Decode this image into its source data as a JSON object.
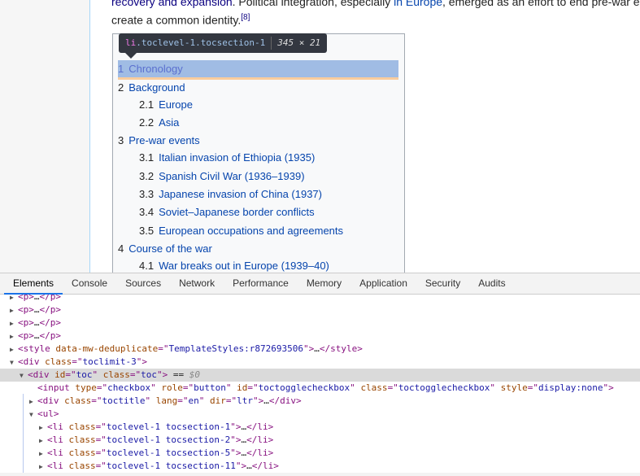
{
  "article": {
    "line1": [
      {
        "text": "recovery and expansion",
        "link": true
      },
      {
        "text": ". Political integration, especially ",
        "link": false
      },
      {
        "text": "in Europe",
        "link": true
      },
      {
        "text": ", emerged as an effort to end pre-war e",
        "link": false
      }
    ],
    "line2": "create a common identity.",
    "ref": "[8]"
  },
  "toc": {
    "items": [
      {
        "num": "1",
        "label": "Chronology",
        "level": 1,
        "highlighted": true
      },
      {
        "num": "2",
        "label": "Background",
        "level": 1
      },
      {
        "num": "2.1",
        "label": "Europe",
        "level": 2
      },
      {
        "num": "2.2",
        "label": "Asia",
        "level": 2
      },
      {
        "num": "3",
        "label": "Pre-war events",
        "level": 1
      },
      {
        "num": "3.1",
        "label": "Italian invasion of Ethiopia (1935)",
        "level": 2
      },
      {
        "num": "3.2",
        "label": "Spanish Civil War (1936–1939)",
        "level": 2
      },
      {
        "num": "3.3",
        "label": "Japanese invasion of China (1937)",
        "level": 2
      },
      {
        "num": "3.4",
        "label": "Soviet–Japanese border conflicts",
        "level": 2
      },
      {
        "num": "3.5",
        "label": "European occupations and agreements",
        "level": 2
      },
      {
        "num": "4",
        "label": "Course of the war",
        "level": 1
      },
      {
        "num": "4.1",
        "label": "War breaks out in Europe (1939–40)",
        "level": 2
      }
    ]
  },
  "tooltip": {
    "tag": "li",
    "classes": ".toclevel-1.tocsection-1",
    "size": "345 × 21"
  },
  "devtools": {
    "tabs": [
      "Elements",
      "Console",
      "Sources",
      "Network",
      "Performance",
      "Memory",
      "Application",
      "Security",
      "Audits"
    ],
    "active_tab": "Elements",
    "lines": [
      {
        "indent": 1,
        "tri": "▶",
        "segs": [
          [
            "t",
            "<p>"
          ],
          [
            "tx",
            "…"
          ],
          [
            "t",
            "</p>"
          ]
        ]
      },
      {
        "indent": 1,
        "tri": "▶",
        "segs": [
          [
            "t",
            "<p>"
          ],
          [
            "tx",
            "…"
          ],
          [
            "t",
            "</p>"
          ]
        ]
      },
      {
        "indent": 1,
        "tri": "▶",
        "segs": [
          [
            "t",
            "<p>"
          ],
          [
            "tx",
            "…"
          ],
          [
            "t",
            "</p>"
          ]
        ]
      },
      {
        "indent": 1,
        "tri": "▶",
        "segs": [
          [
            "t",
            "<p>"
          ],
          [
            "tx",
            "…"
          ],
          [
            "t",
            "</p>"
          ]
        ]
      },
      {
        "indent": 1,
        "tri": "▶",
        "segs": [
          [
            "t",
            "<style "
          ],
          [
            "an",
            "data-mw-deduplicate"
          ],
          [
            "t",
            "=\""
          ],
          [
            "av",
            "TemplateStyles:r872693506"
          ],
          [
            "t",
            "\">"
          ],
          [
            "tx",
            "…"
          ],
          [
            "t",
            "</style>"
          ]
        ]
      },
      {
        "indent": 1,
        "tri": "▼",
        "segs": [
          [
            "t",
            "<div "
          ],
          [
            "an",
            "class"
          ],
          [
            "t",
            "=\""
          ],
          [
            "av",
            "toclimit-3"
          ],
          [
            "t",
            "\">"
          ]
        ]
      },
      {
        "indent": 2,
        "tri": "▼",
        "selected": true,
        "segs": [
          [
            "t",
            "<div "
          ],
          [
            "an",
            "id"
          ],
          [
            "t",
            "=\""
          ],
          [
            "av",
            "toc"
          ],
          [
            "t",
            "\" "
          ],
          [
            "an",
            "class"
          ],
          [
            "t",
            "=\""
          ],
          [
            "av",
            "toc"
          ],
          [
            "t",
            "\">"
          ],
          [
            "tx",
            " == "
          ],
          [
            "dim",
            "$0"
          ]
        ]
      },
      {
        "indent": 3,
        "tri": "",
        "segs": [
          [
            "t",
            "<input "
          ],
          [
            "an",
            "type"
          ],
          [
            "t",
            "=\""
          ],
          [
            "av",
            "checkbox"
          ],
          [
            "t",
            "\" "
          ],
          [
            "an",
            "role"
          ],
          [
            "t",
            "=\""
          ],
          [
            "av",
            "button"
          ],
          [
            "t",
            "\" "
          ],
          [
            "an",
            "id"
          ],
          [
            "t",
            "=\""
          ],
          [
            "av",
            "toctogglecheckbox"
          ],
          [
            "t",
            "\" "
          ],
          [
            "an",
            "class"
          ],
          [
            "t",
            "=\""
          ],
          [
            "av",
            "toctogglecheckbox"
          ],
          [
            "t",
            "\" "
          ],
          [
            "an",
            "style"
          ],
          [
            "t",
            "=\""
          ],
          [
            "av",
            "display:none"
          ],
          [
            "t",
            "\">"
          ]
        ]
      },
      {
        "indent": 3,
        "tri": "▶",
        "segs": [
          [
            "t",
            "<div "
          ],
          [
            "an",
            "class"
          ],
          [
            "t",
            "=\""
          ],
          [
            "av",
            "toctitle"
          ],
          [
            "t",
            "\" "
          ],
          [
            "an",
            "lang"
          ],
          [
            "t",
            "=\""
          ],
          [
            "av",
            "en"
          ],
          [
            "t",
            "\" "
          ],
          [
            "an",
            "dir"
          ],
          [
            "t",
            "=\""
          ],
          [
            "av",
            "ltr"
          ],
          [
            "t",
            "\">"
          ],
          [
            "tx",
            "…"
          ],
          [
            "t",
            "</div>"
          ]
        ]
      },
      {
        "indent": 3,
        "tri": "▼",
        "segs": [
          [
            "t",
            "<ul>"
          ]
        ]
      },
      {
        "indent": 4,
        "tri": "▶",
        "segs": [
          [
            "t",
            "<li "
          ],
          [
            "an",
            "class"
          ],
          [
            "t",
            "=\""
          ],
          [
            "av",
            "toclevel-1 tocsection-1"
          ],
          [
            "t",
            "\">"
          ],
          [
            "tx",
            "…"
          ],
          [
            "t",
            "</li>"
          ]
        ]
      },
      {
        "indent": 4,
        "tri": "▶",
        "segs": [
          [
            "t",
            "<li "
          ],
          [
            "an",
            "class"
          ],
          [
            "t",
            "=\""
          ],
          [
            "av",
            "toclevel-1 tocsection-2"
          ],
          [
            "t",
            "\">"
          ],
          [
            "tx",
            "…"
          ],
          [
            "t",
            "</li>"
          ]
        ]
      },
      {
        "indent": 4,
        "tri": "▶",
        "segs": [
          [
            "t",
            "<li "
          ],
          [
            "an",
            "class"
          ],
          [
            "t",
            "=\""
          ],
          [
            "av",
            "toclevel-1 tocsection-5"
          ],
          [
            "t",
            "\">"
          ],
          [
            "tx",
            "…"
          ],
          [
            "t",
            "</li>"
          ]
        ]
      },
      {
        "indent": 4,
        "tri": "▶",
        "segs": [
          [
            "t",
            "<li "
          ],
          [
            "an",
            "class"
          ],
          [
            "t",
            "=\""
          ],
          [
            "av",
            "toclevel-1 tocsection-11"
          ],
          [
            "t",
            "\">"
          ],
          [
            "tx",
            "…"
          ],
          [
            "t",
            "</li>"
          ]
        ]
      }
    ]
  }
}
